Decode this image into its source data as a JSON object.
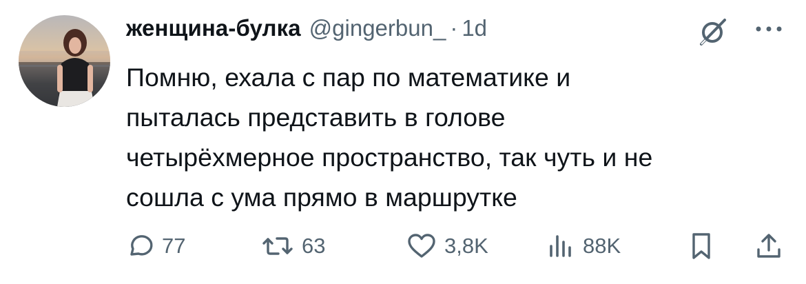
{
  "author": {
    "display_name": "женщина-булка",
    "handle": "@gingerbun_",
    "separator": "·",
    "time": "1d"
  },
  "icons": {
    "grok": "grok-icon",
    "more": "more-icon",
    "reply": "reply-icon",
    "retweet": "retweet-icon",
    "like": "heart-icon",
    "views": "views-icon",
    "bookmark": "bookmark-icon",
    "share": "share-icon"
  },
  "tweet": {
    "text": "Помню, ехала с пар по математике и\nпыталась представить в голове\nчетырёхмерное пространство, так чуть и не\nсошла с ума прямо в маршрутке"
  },
  "actions": {
    "replies": "77",
    "reposts": "63",
    "likes": "3,8K",
    "views": "88K"
  },
  "colors": {
    "text": "#0f1419",
    "secondary": "#536471",
    "background": "#ffffff"
  }
}
